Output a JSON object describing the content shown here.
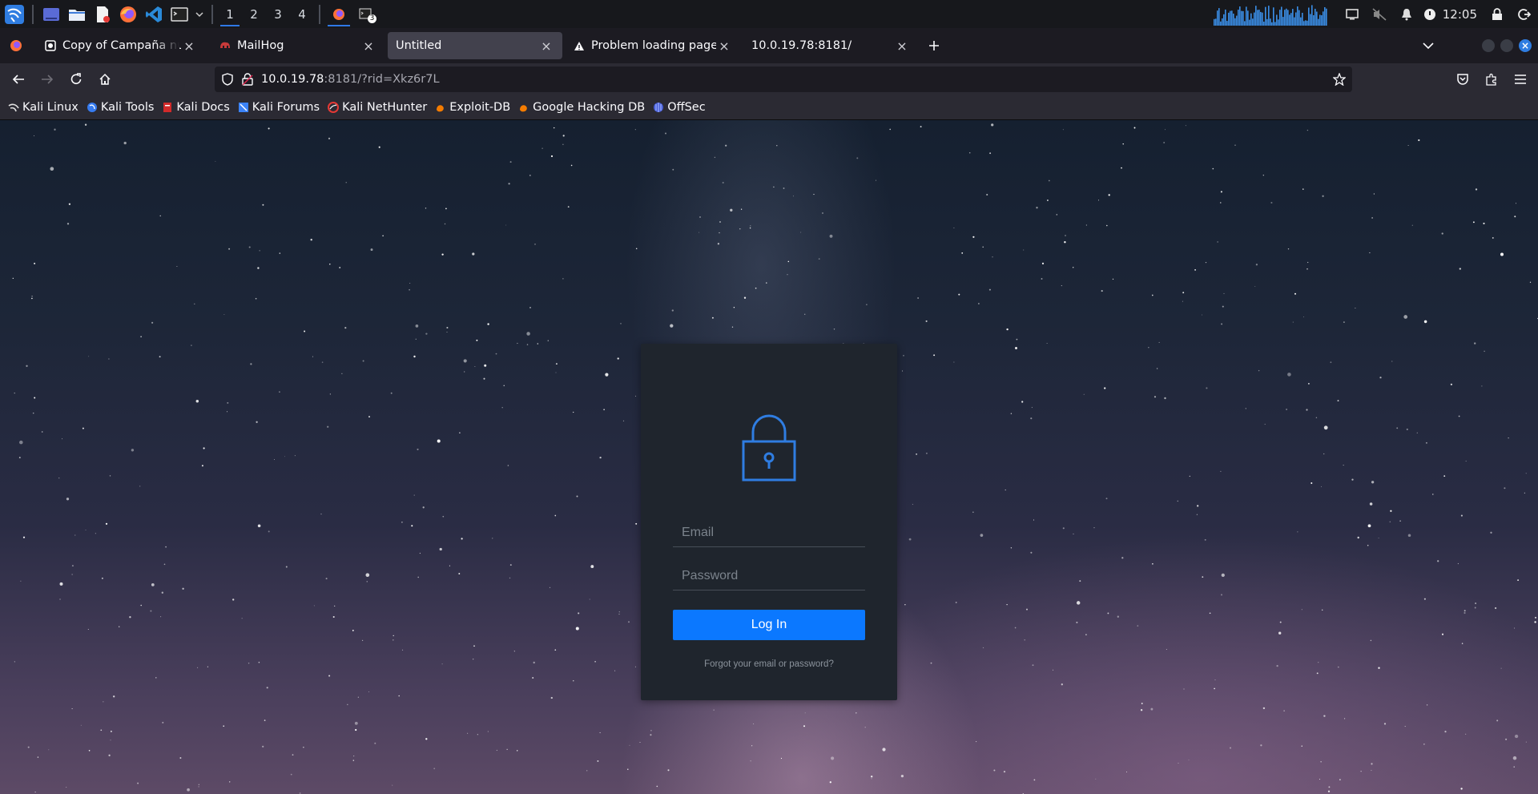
{
  "taskbar": {
    "workspaces": [
      "1",
      "2",
      "3",
      "4"
    ],
    "active_workspace": "1",
    "terminal_badge": "3",
    "clock": "12:05"
  },
  "tabs": [
    {
      "title": "Copy of Campaña nuevo ingreso",
      "icon": "document-icon"
    },
    {
      "title": "MailHog",
      "icon": "mailhog-icon"
    },
    {
      "title": "Untitled",
      "icon": "",
      "selected": true
    },
    {
      "title": "Problem loading page",
      "icon": "warning-icon"
    },
    {
      "title": "10.0.19.78:8181/",
      "icon": ""
    }
  ],
  "urlbar": {
    "host": "10.0.19.78",
    "rest": ":8181/?rid=Xkz6r7L"
  },
  "bookmarks": [
    {
      "label": "Kali Linux",
      "color": "#e0e0e0"
    },
    {
      "label": "Kali Tools",
      "color": "#367bf0"
    },
    {
      "label": "Kali Docs",
      "color": "#d22a2a"
    },
    {
      "label": "Kali Forums",
      "color": "#3b82f6"
    },
    {
      "label": "Kali NetHunter",
      "color": "#e53935"
    },
    {
      "label": "Exploit-DB",
      "color": "#f57c00"
    },
    {
      "label": "Google Hacking DB",
      "color": "#f57c00"
    },
    {
      "label": "OffSec",
      "color": "#6f8cff"
    }
  ],
  "login": {
    "email_placeholder": "Email",
    "password_placeholder": "Password",
    "button_label": "Log In",
    "forgot_link": "Forgot your email or password?",
    "accent_color": "#0b78ff"
  }
}
